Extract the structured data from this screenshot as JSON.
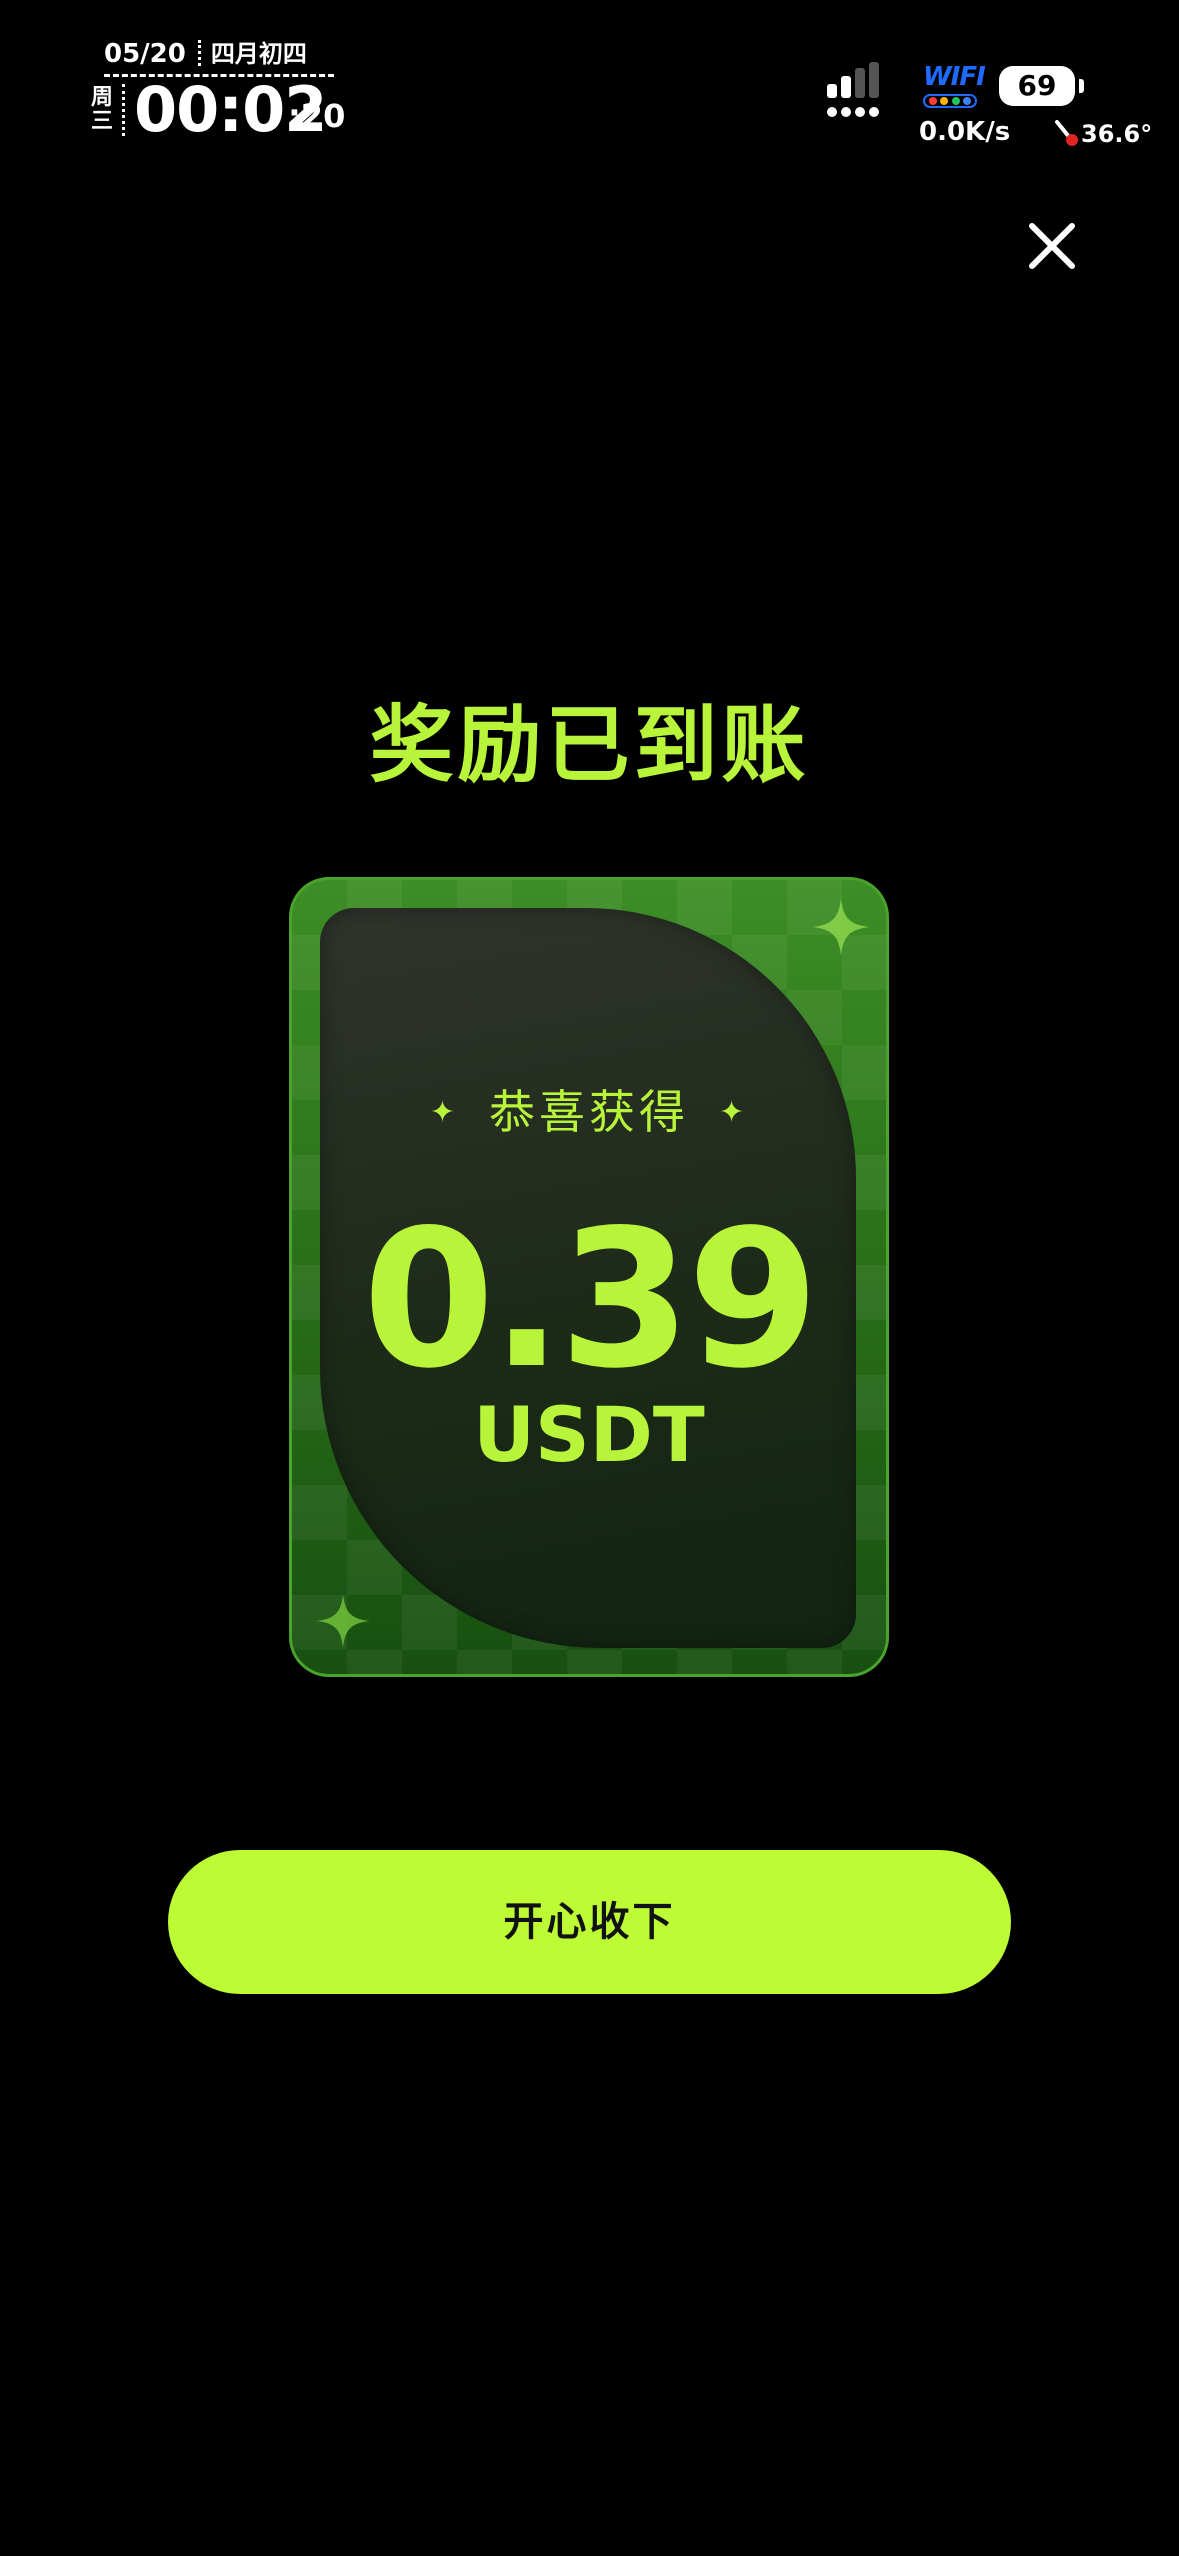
{
  "status_bar": {
    "date": "05/20",
    "lunar_date": "四月初四",
    "weekday": "周三",
    "time": "00:02",
    "seconds": ":20",
    "wifi_label": "WIFI",
    "battery": "69",
    "net_speed": "0.0K/s",
    "temperature": "36.6°"
  },
  "dialog": {
    "title": "奖励已到账",
    "card": {
      "congrats": "恭喜获得",
      "amount": "0.39",
      "currency": "USDT"
    },
    "confirm_label": "开心收下",
    "close_icon": "close-icon"
  },
  "colors": {
    "accent": "#b8f53a",
    "button": "#bdfb35",
    "background": "#000000",
    "card_green": "#2a7219",
    "wifi_blue": "#1f6bff"
  }
}
